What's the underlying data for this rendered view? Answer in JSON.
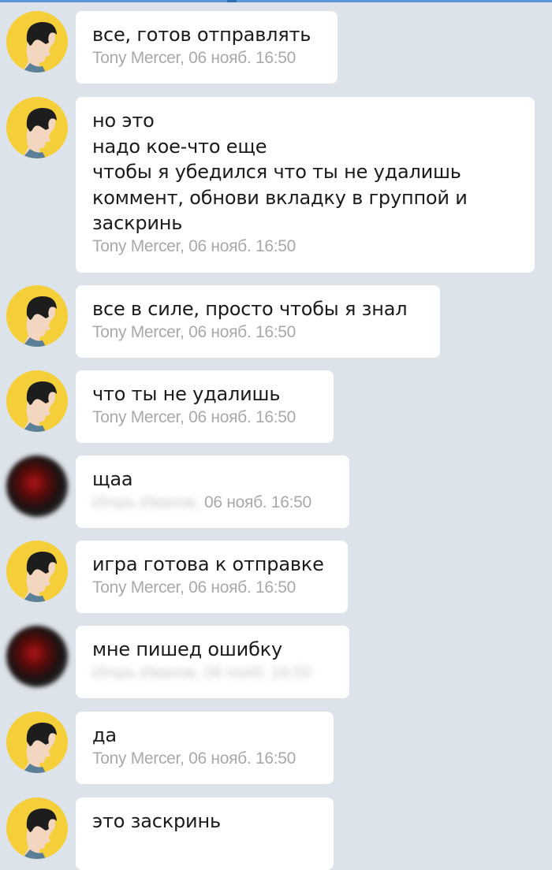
{
  "app": {
    "accent_color": "#5b9ad6",
    "background_color": "#dde3ea",
    "bubble_color": "#ffffff",
    "meta_color": "#a7a9ab",
    "tony_avatar_color": "#f5cf3a"
  },
  "messages": [
    {
      "text": "все, готов отправлять",
      "author": "Tony Mercer",
      "date": "06 нояб.",
      "time": "16:50",
      "meta": "Tony Mercer, 06 нояб. 16:50",
      "avatar": "tony-avatar"
    },
    {
      "text": "но это\nнадо кое-что еще\nчтобы я убедился что ты не удалишь\nкоммент, обнови вкладку в группой и\nзаскринь",
      "author": "Tony Mercer",
      "date": "06 нояб.",
      "time": "16:50",
      "meta": "Tony Mercer, 06 нояб. 16:50",
      "avatar": "tony-avatar"
    },
    {
      "text": "все в силе, просто чтобы я знал",
      "author": "Tony Mercer",
      "date": "06 нояб.",
      "time": "16:50",
      "meta": "Tony Mercer, 06 нояб. 16:50",
      "avatar": "tony-avatar"
    },
    {
      "text": "что ты не удалишь",
      "author": "Tony Mercer",
      "date": "06 нояб.",
      "time": "16:50",
      "meta": "Tony Mercer, 06 нояб. 16:50",
      "avatar": "tony-avatar"
    },
    {
      "text": "щаа",
      "author_blurred": "Игорь Иванов, ",
      "meta_visible": "06 нояб. 16:50",
      "avatar": "blurred-avatar"
    },
    {
      "text": "игра готова к отправке",
      "author": "Tony Mercer",
      "date": "06 нояб.",
      "time": "16:50",
      "meta": "Tony Mercer, 06 нояб. 16:50",
      "avatar": "tony-avatar"
    },
    {
      "text": "мне пишед ошибку",
      "meta_blurred": "Игорь Иванов, 06 нояб. 16:50",
      "avatar": "blurred-avatar"
    },
    {
      "text": "да",
      "author": "Tony Mercer",
      "date": "06 нояб.",
      "time": "16:50",
      "meta": "Tony Mercer, 06 нояб. 16:50",
      "avatar": "tony-avatar"
    },
    {
      "text": "это заскринь",
      "avatar": "tony-avatar"
    }
  ]
}
